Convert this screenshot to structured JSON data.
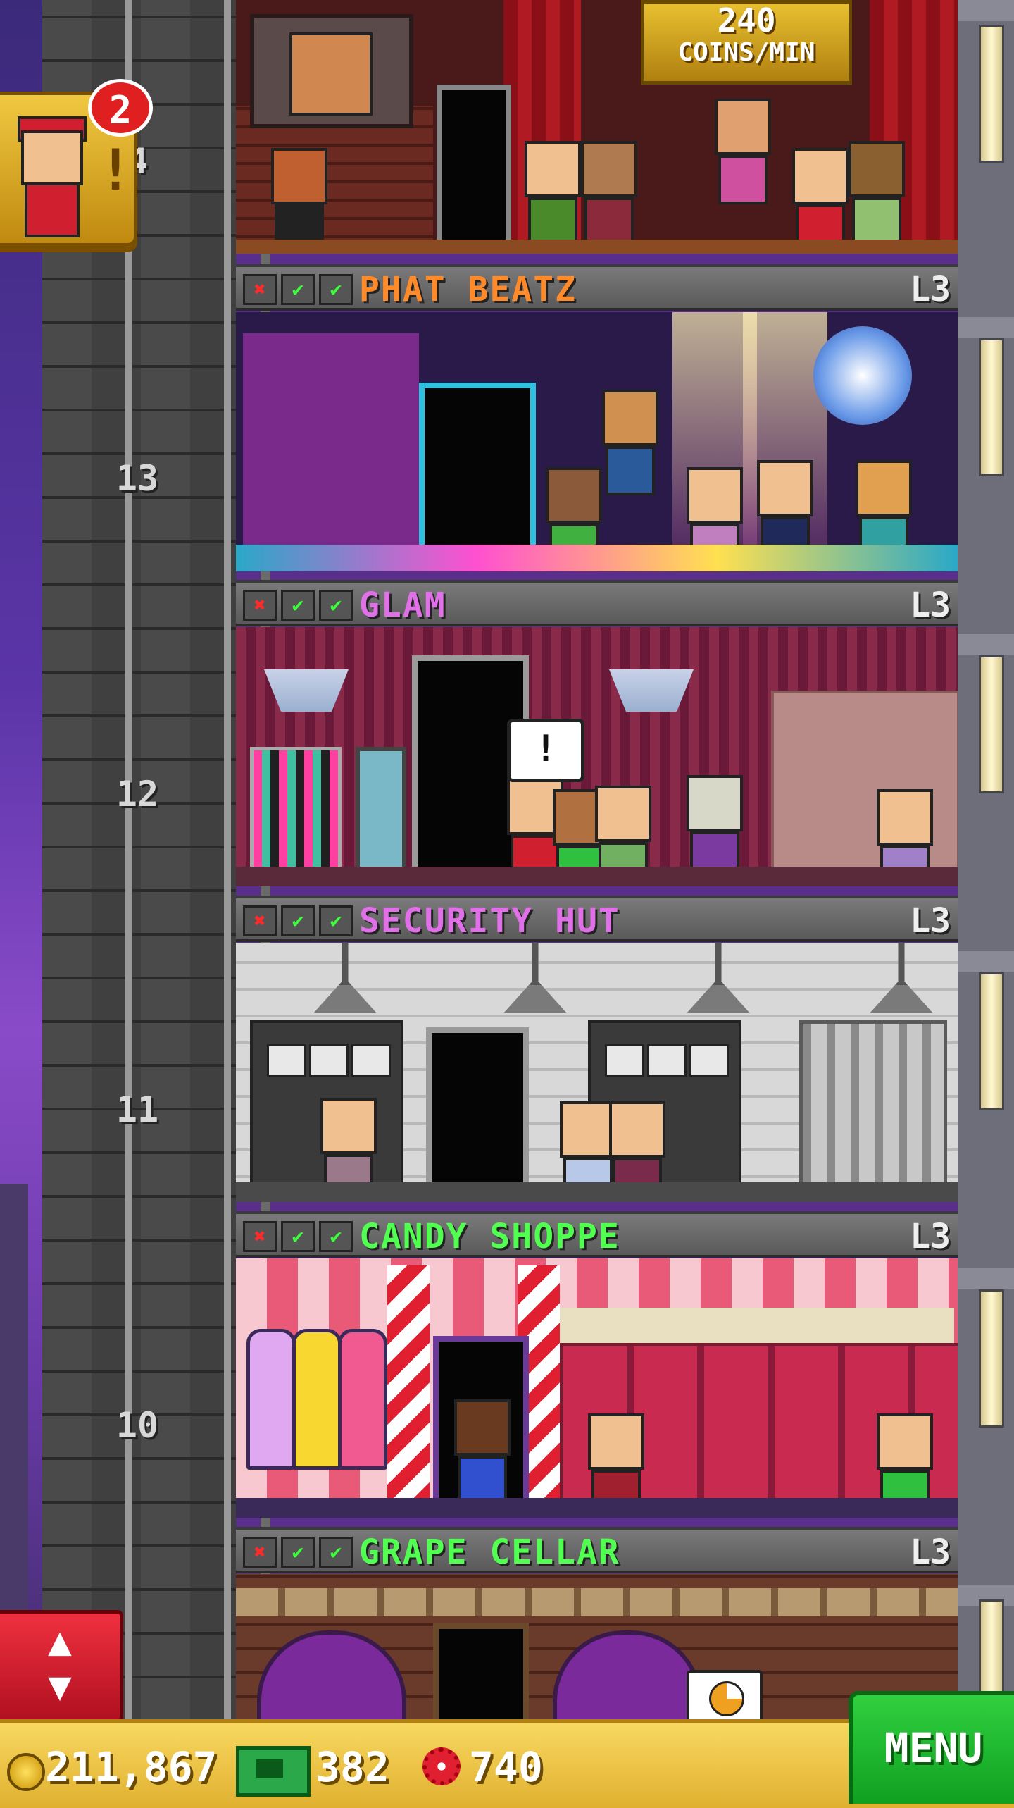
{
  "header": {
    "coins_rate_value": "240",
    "coins_rate_unit": "COINS/MIN",
    "partial_floor_number": "4"
  },
  "notifications": {
    "bellhop_badge_count": "2",
    "bellhop_alert": "!"
  },
  "floors": [
    {
      "number": "13",
      "name": "PHAT BEATZ",
      "level": "L3",
      "name_color": "#ff8a2a"
    },
    {
      "number": "12",
      "name": "GLAM",
      "level": "L3",
      "name_color": "#e070e8"
    },
    {
      "number": "11",
      "name": "SECURITY HUT",
      "level": "L3",
      "name_color": "#e070e8"
    },
    {
      "number": "10",
      "name": "CANDY SHOPPE",
      "level": "L3",
      "name_color": "#50ff50"
    },
    {
      "number": "",
      "name": "GRAPE CELLAR",
      "level": "L3",
      "name_color": "#50ff50"
    }
  ],
  "stock_marks": {
    "unavailable": "✖",
    "available": "✔"
  },
  "speech_bubble": "!",
  "bottom_bar": {
    "coins": "211,867",
    "tower_bux": "382",
    "gears": "740",
    "menu_label": "MENU"
  },
  "elevator_button": {
    "up_arrow": "▲",
    "down_arrow": "▼"
  },
  "icons": [
    "coin-icon",
    "tower-bux-icon",
    "gear-icon",
    "bellhop-icon",
    "elevator-arrows-icon",
    "pie-timer-icon"
  ]
}
